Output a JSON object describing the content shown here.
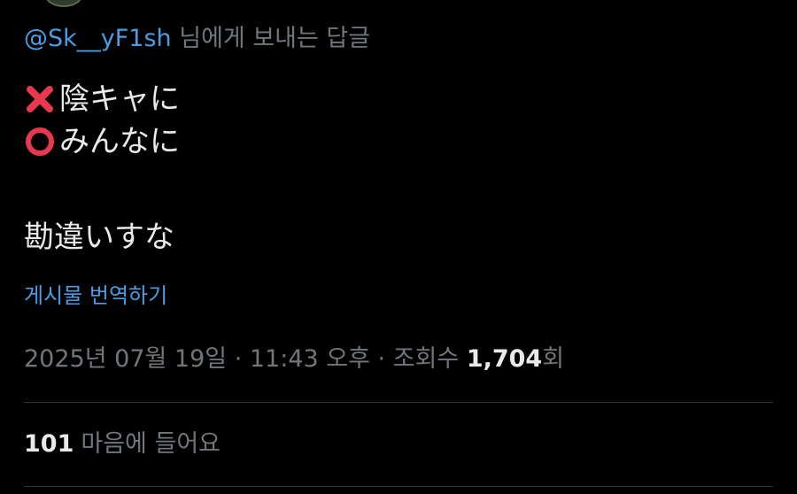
{
  "reply": {
    "handle": "@Sk__yF1sh",
    "suffix": " 님에게 보내는 답글"
  },
  "tweet": {
    "line1": {
      "icon": "cross-mark-icon",
      "text": "陰キャに"
    },
    "line2": {
      "icon": "hollow-red-circle-icon",
      "text": "みんなに"
    },
    "line3": {
      "text": "勘違いすな"
    }
  },
  "translate_label": "게시물 번역하기",
  "meta": {
    "date": "2025년 07월 19일",
    "sep1": " · ",
    "time": "11:43 오후",
    "sep2": " · ",
    "views_label": "조회수 ",
    "views_count": "1,704",
    "views_suffix": "회"
  },
  "likes": {
    "count": "101",
    "label": "마음에 들어요"
  },
  "colors": {
    "background": "#000000",
    "text": "#e7e9ea",
    "secondary": "#71767b",
    "link": "#4a9de5",
    "divider": "#2f3336",
    "cross": "#e8384f",
    "circle": "#e8384f"
  }
}
